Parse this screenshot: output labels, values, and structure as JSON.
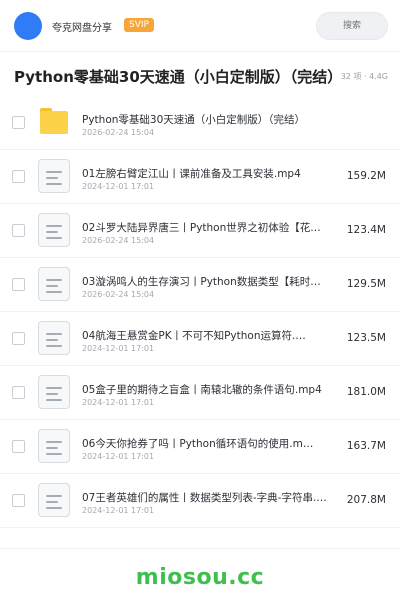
{
  "header": {
    "brand": "夸克网盘分享",
    "badge": "SVIP",
    "search_placeholder": "搜索"
  },
  "folder_title": {
    "title": "Python零基础30天速通（小白定制版）（完结）",
    "meta": "32 项 · 4.4G"
  },
  "items": [
    {
      "type": "folder",
      "name": "Python零基础30天速通（小白定制版）（完结）",
      "date": "2026-02-24 15:04",
      "size": ""
    },
    {
      "type": "file",
      "name": "01左膀右臂定江山丨课前准备及工具安装.mp4",
      "date": "2024-12-01 17:01",
      "size": "159.2M"
    },
    {
      "type": "file",
      "name": "02斗罗大陆异界唐三丨Python世界之初体验【花…",
      "date": "2026-02-24 15:04",
      "size": "123.4M"
    },
    {
      "type": "file",
      "name": "03漩涡鸣人的生存演习丨Python数据类型【耗时…",
      "date": "2026-02-24 15:04",
      "size": "129.5M"
    },
    {
      "type": "file",
      "name": "04航海王悬赏金PK丨不可不知Python运算符.…",
      "date": "2024-12-01 17:01",
      "size": "123.5M"
    },
    {
      "type": "file",
      "name": "05盒子里的期待之盲盒丨南辕北辙的条件语句.mp4",
      "date": "2024-12-01 17:01",
      "size": "181.0M"
    },
    {
      "type": "file",
      "name": "06今天你抢券了吗丨Python循环语句的使用.m…",
      "date": "2024-12-01 17:01",
      "size": "163.7M"
    },
    {
      "type": "file",
      "name": "07王者英雄们的属性丨数据类型列表-字典-字符串.…",
      "date": "2024-12-01 17:01",
      "size": "207.8M"
    }
  ],
  "watermark": "miosou.cc",
  "colors": {
    "accent": "#2f7cf6",
    "svip": "#f7a63a",
    "folder": "#fbd249",
    "watermark": "#3fbf4d"
  },
  "icons": {
    "folder": "folder-icon",
    "file": "video-file-icon"
  }
}
